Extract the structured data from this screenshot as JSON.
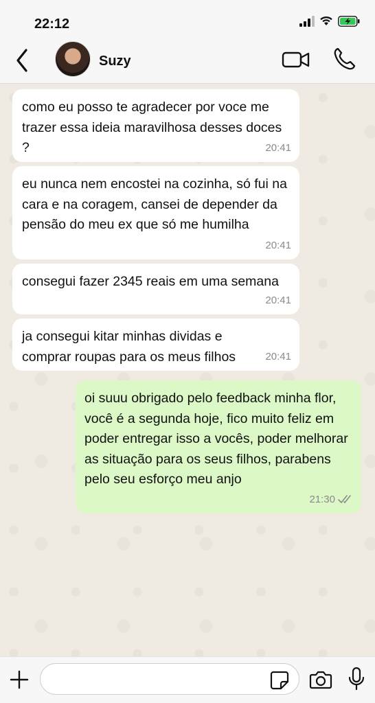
{
  "status_bar": {
    "time": "22:12",
    "icons": [
      "signal-icon",
      "wifi-icon",
      "battery-charging-icon"
    ]
  },
  "header": {
    "contact_name": "Suzy",
    "icons": [
      "back-icon",
      "avatar",
      "video-call-icon",
      "phone-icon"
    ]
  },
  "messages": [
    {
      "direction": "in",
      "text": "como eu posso te agradecer por voce me trazer essa ideia maravilhosa desses doces ?",
      "time": "20:41"
    },
    {
      "direction": "in",
      "text": "eu nunca nem encostei na cozinha, só fui na cara e na coragem, cansei de depender da pensão do meu ex que só me humilha",
      "time": "20:41"
    },
    {
      "direction": "in",
      "text": "consegui fazer 2345 reais em uma semana",
      "time": "20:41"
    },
    {
      "direction": "in",
      "text": "ja consegui kitar minhas dividas e comprar roupas para os meus filhos",
      "time": "20:41"
    },
    {
      "direction": "out",
      "text": "oi suuu obrigado pelo feedback minha flor, você é a segunda hoje, fico muito feliz em poder entregar isso a vocês, poder melhorar as situação para os seus filhos, parabens pelo seu esforço meu anjo",
      "time": "21:30",
      "status": "read"
    }
  ],
  "input_bar": {
    "value": "",
    "icons": [
      "plus-icon",
      "sticker-icon",
      "camera-icon",
      "microphone-icon"
    ]
  },
  "colors": {
    "incoming_bubble": "#ffffff",
    "outgoing_bubble": "#dcf8c6",
    "chat_background": "#efeae2",
    "bar_background": "#f7f7f7",
    "read_check": "#8a8a8a",
    "battery_fill": "#34c759"
  }
}
